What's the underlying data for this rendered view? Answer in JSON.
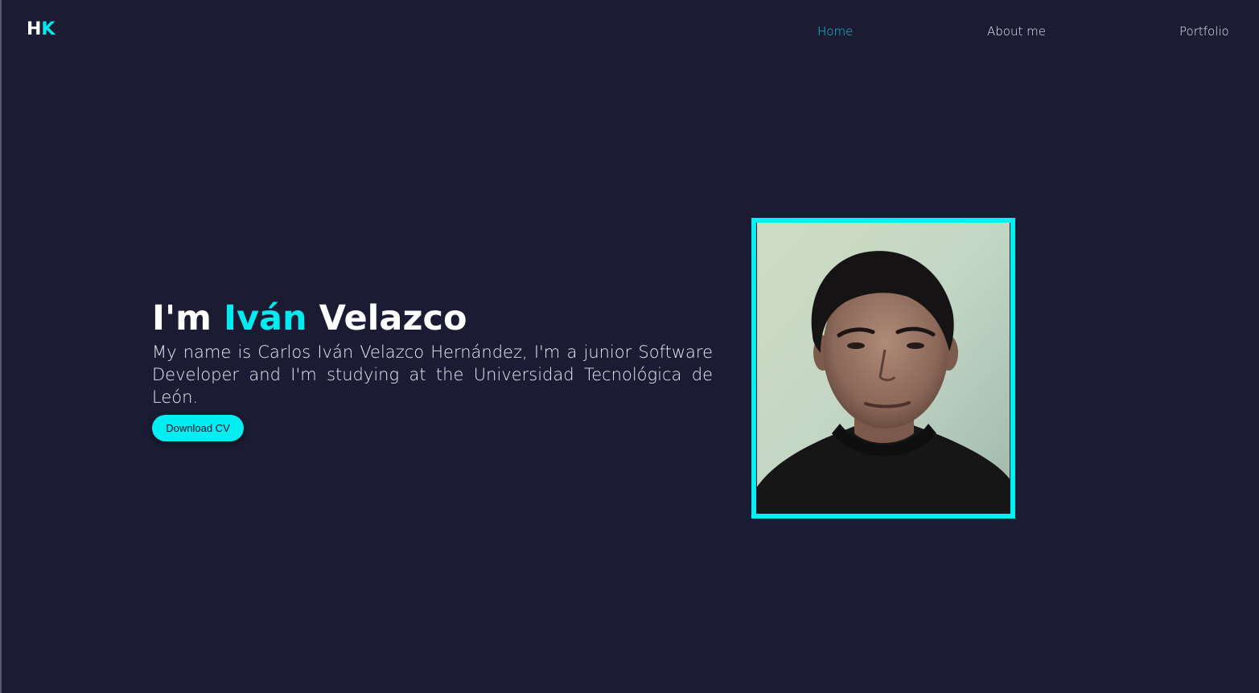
{
  "logo": {
    "first": "H",
    "second": "K"
  },
  "nav": {
    "home": "Home",
    "about": "About me",
    "portfolio": "Portfolio"
  },
  "hero": {
    "title_prefix": "I'm ",
    "title_name": "Iván",
    "title_suffix": " Velazco",
    "description": "My name is Carlos Iván Velazco Hernández, I'm a junior Software Developer and I'm studying at the Universidad Tecnológica de León.",
    "cv_button": "Download CV"
  },
  "colors": {
    "background": "#1b1c33",
    "accent": "#00eaf0",
    "text": "#ffffff"
  }
}
